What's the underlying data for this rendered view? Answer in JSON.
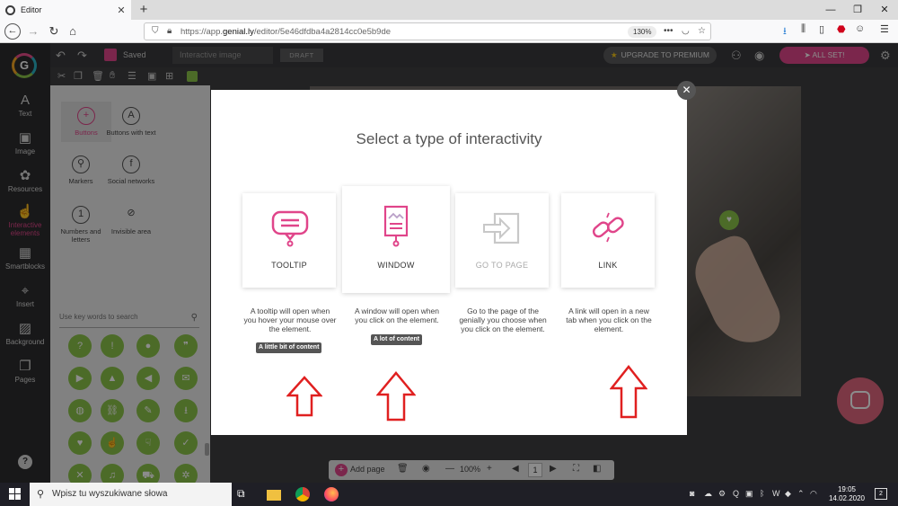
{
  "browser": {
    "tab_title": "Editor",
    "url_prefix": "https://app.",
    "url_domain": "genial.ly",
    "url_path": "/editor/5e46dfdba4a2814cc0e5b9de",
    "zoom": "130%"
  },
  "app": {
    "saved_label": "Saved",
    "title_placeholder": "Interactive image",
    "draft_label": "DRAFT",
    "upgrade_label": "UPGRADE TO PREMIUM",
    "allset_label": "ALL SET!",
    "rail": [
      {
        "label": "Text",
        "icon": "A"
      },
      {
        "label": "Image",
        "icon": "▣"
      },
      {
        "label": "Resources",
        "icon": "✿"
      },
      {
        "label": "Interactive elements",
        "icon": "☝"
      },
      {
        "label": "Smartblocks",
        "icon": "▦"
      },
      {
        "label": "Insert",
        "icon": "⌖"
      },
      {
        "label": "Background",
        "icon": "▨"
      },
      {
        "label": "Pages",
        "icon": "❐"
      }
    ],
    "help_label": "?",
    "panel": {
      "buttons": "Buttons",
      "buttons_text": "Buttons with text",
      "markers": "Markers",
      "social": "Social networks",
      "numbers": "Numbers and letters",
      "invisible": "Invisible area",
      "search_placeholder": "Use key words to search"
    },
    "bottom": {
      "add_page": "Add page",
      "zoom": "100%",
      "page": "1"
    }
  },
  "modal": {
    "title": "Select a type of interactivity",
    "options": [
      {
        "label": "TOOLTIP",
        "desc": "A tooltip will open when you hover your mouse over the element.",
        "chip": "A little bit of content"
      },
      {
        "label": "WINDOW",
        "desc": "A window will open when you click on the element.",
        "chip": "A lot of content"
      },
      {
        "label": "GO TO PAGE",
        "desc": "Go to the page of the genially you choose when you click on the element."
      },
      {
        "label": "LINK",
        "desc": "A link will open in a new tab when you click on the element."
      }
    ]
  },
  "taskbar": {
    "search_placeholder": "Wpisz tu wyszukiwane słowa",
    "time": "19:05",
    "date": "14.02.2020",
    "notifications": "2"
  },
  "colors": {
    "accent": "#e0458a",
    "green": "#8bc34a",
    "arrow": "#e02020"
  }
}
